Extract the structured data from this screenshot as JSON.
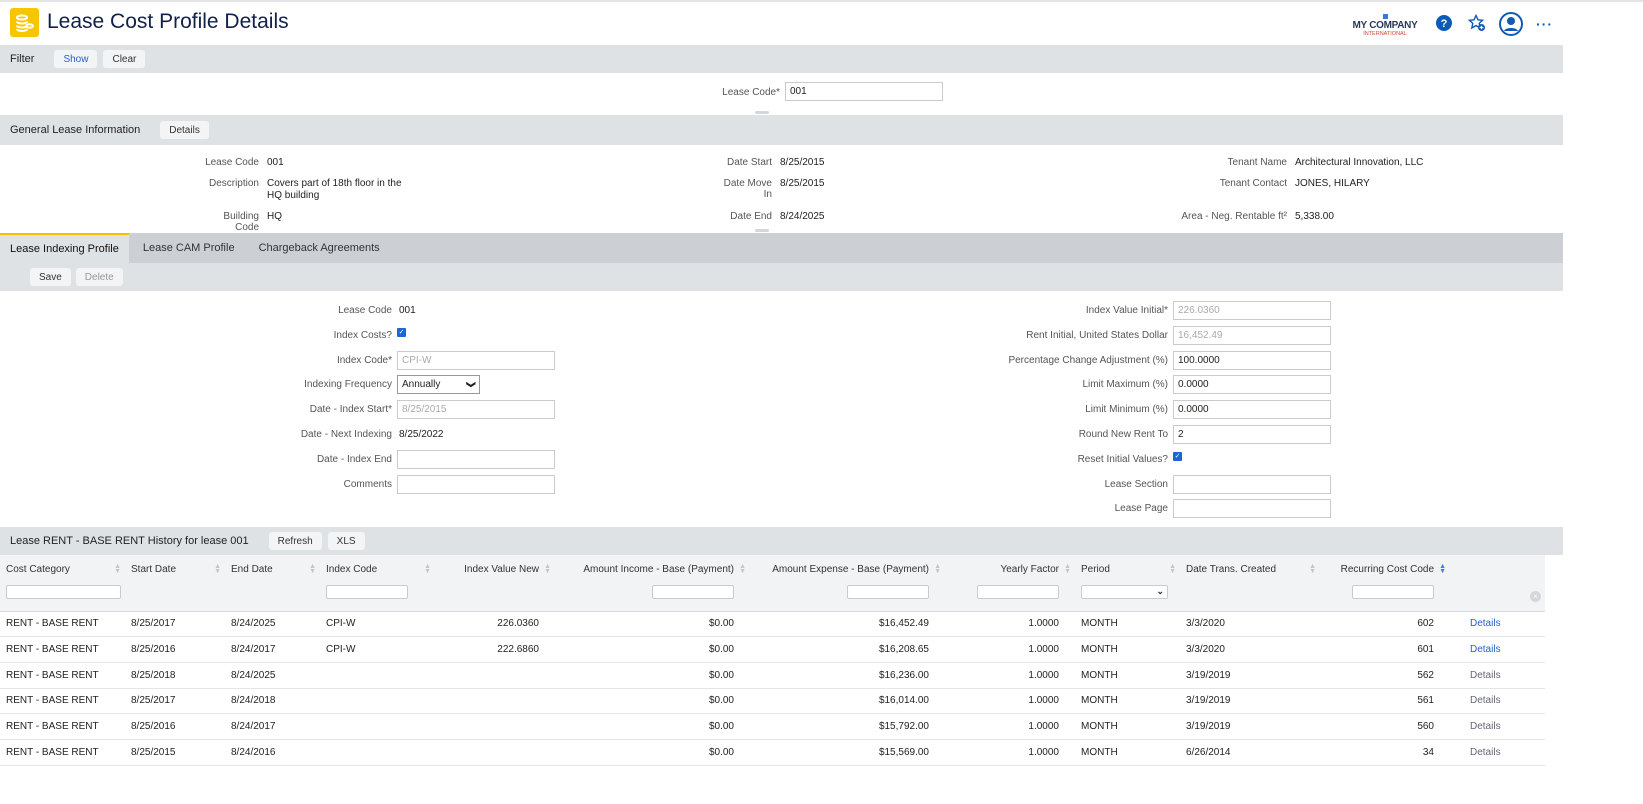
{
  "header": {
    "title": "Lease Cost Profile Details",
    "company": "MY COMPANY",
    "company_sub": "INTERNATIONAL"
  },
  "filter": {
    "title": "Filter",
    "show": "Show",
    "clear": "Clear",
    "lease_code_label": "Lease Code*",
    "lease_code_value": "001"
  },
  "general": {
    "title": "General Lease Information",
    "details": "Details",
    "fields": [
      {
        "label": "Lease Code",
        "value": "001"
      },
      {
        "label": "Description",
        "value": "Covers part of 18th floor in the HQ building"
      },
      {
        "label": "Building Code",
        "value": "HQ"
      },
      {
        "label": "Date Start",
        "value": "8/25/2015"
      },
      {
        "label": "Date Move In",
        "value": "8/25/2015"
      },
      {
        "label": "Date End",
        "value": "8/24/2025"
      },
      {
        "label": "Tenant Name",
        "value": "Architectural Innovation, LLC"
      },
      {
        "label": "Tenant Contact",
        "value": "JONES, HILARY"
      },
      {
        "label": "Area - Neg. Rentable ft²",
        "value": "5,338.00"
      }
    ]
  },
  "tabs": [
    "Lease Indexing Profile",
    "Lease CAM Profile",
    "Chargeback Agreements"
  ],
  "toolbar": {
    "save": "Save",
    "delete": "Delete"
  },
  "form": {
    "left": [
      {
        "label": "Lease Code",
        "value": "001",
        "type": "text"
      },
      {
        "label": "Index Costs?",
        "value": "",
        "type": "check"
      },
      {
        "label": "Index Code*",
        "value": "CPI-W",
        "type": "ro"
      },
      {
        "label": "Indexing Frequency",
        "value": "Annually",
        "type": "select"
      },
      {
        "label": "Date - Index Start*",
        "value": "8/25/2015",
        "type": "ro"
      },
      {
        "label": "Date - Next Indexing",
        "value": "8/25/2022",
        "type": "text"
      },
      {
        "label": "Date - Index End",
        "value": "",
        "type": "input"
      },
      {
        "label": "Comments",
        "value": "",
        "type": "input"
      }
    ],
    "right": [
      {
        "label": "Index Value Initial*",
        "value": "226.0360",
        "type": "ro"
      },
      {
        "label": "Rent Initial, United States Dollar",
        "value": "16,452.49",
        "type": "ro"
      },
      {
        "label": "Percentage Change Adjustment (%)",
        "value": "100.0000",
        "type": "input"
      },
      {
        "label": "Limit Maximum (%)",
        "value": "0.0000",
        "type": "input"
      },
      {
        "label": "Limit Minimum (%)",
        "value": "0.0000",
        "type": "input"
      },
      {
        "label": "Round New Rent To",
        "value": "2",
        "type": "input"
      },
      {
        "label": "Reset Initial Values?",
        "value": "",
        "type": "check"
      },
      {
        "label": "Lease Section",
        "value": "",
        "type": "input"
      },
      {
        "label": "Lease Page",
        "value": "",
        "type": "input"
      }
    ]
  },
  "grid": {
    "title": "Lease RENT - BASE RENT History for lease 001",
    "refresh": "Refresh",
    "xls": "XLS",
    "columns": [
      "Cost Category",
      "Start Date",
      "End Date",
      "Index Code",
      "Index Value New",
      "Amount Income - Base (Payment)",
      "Amount Expense - Base (Payment)",
      "Yearly Factor",
      "Period",
      "Date Trans. Created",
      "Recurring Cost Code"
    ],
    "rows": [
      [
        "RENT - BASE RENT",
        "8/25/2017",
        "8/24/2025",
        "CPI-W",
        "226.0360",
        "$0.00",
        "$16,452.49",
        "1.0000",
        "MONTH",
        "3/3/2020",
        "602",
        "Details"
      ],
      [
        "RENT - BASE RENT",
        "8/25/2016",
        "8/24/2017",
        "CPI-W",
        "222.6860",
        "$0.00",
        "$16,208.65",
        "1.0000",
        "MONTH",
        "3/3/2020",
        "601",
        "Details"
      ],
      [
        "RENT - BASE RENT",
        "8/25/2018",
        "8/24/2025",
        "",
        "",
        "$0.00",
        "$16,236.00",
        "1.0000",
        "MONTH",
        "3/19/2019",
        "562",
        "Details"
      ],
      [
        "RENT - BASE RENT",
        "8/25/2017",
        "8/24/2018",
        "",
        "",
        "$0.00",
        "$16,014.00",
        "1.0000",
        "MONTH",
        "3/19/2019",
        "561",
        "Details"
      ],
      [
        "RENT - BASE RENT",
        "8/25/2016",
        "8/24/2017",
        "",
        "",
        "$0.00",
        "$15,792.00",
        "1.0000",
        "MONTH",
        "3/19/2019",
        "560",
        "Details"
      ],
      [
        "RENT - BASE RENT",
        "8/25/2015",
        "8/24/2016",
        "",
        "",
        "$0.00",
        "$15,569.00",
        "1.0000",
        "MONTH",
        "6/26/2014",
        "34",
        "Details"
      ]
    ]
  },
  "colors": {
    "accent": "#f8c600",
    "link": "#2a5ec9",
    "bar": "#dfe2e5"
  }
}
